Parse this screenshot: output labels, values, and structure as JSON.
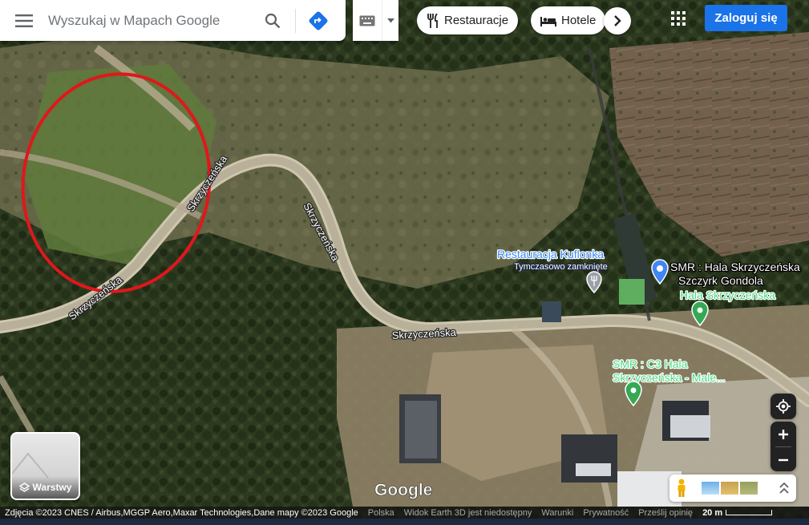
{
  "search": {
    "placeholder": "Wyszukaj w Mapach Google"
  },
  "chips": [
    {
      "label": "Restauracje",
      "icon": "fork-knife-icon"
    },
    {
      "label": "Hotele",
      "icon": "bed-icon"
    }
  ],
  "header": {
    "signin_label": "Zaloguj się"
  },
  "layers": {
    "label": "Warstwy"
  },
  "map": {
    "roads": [
      "Skrzyczeńska",
      "Skrzyczeńska",
      "Skrzyczeńska",
      "Skrzyczeńska"
    ],
    "places": {
      "restaurant_name": "Restauracja Kuflonka",
      "restaurant_status": "Tymczasowo zamknięte",
      "gondola_line1": "SMR : Hala Skrzyczeńska",
      "gondola_line2": "Szczyrk Gondola",
      "hala_name": "Hala Skrzyczeńska",
      "c3_line1": "SMR : C3 Hala",
      "c3_line2": "Skrzyczeńska - Male..."
    },
    "google_logo": "Google"
  },
  "footer": {
    "imagery": "Zdjęcia ©2023 CNES / Airbus,MGGP Aero,Maxar Technologies,Dane mapy ©2023 Google",
    "country": "Polska",
    "earth3d": "Widok Earth 3D jest niedostępny",
    "terms": "Warunki",
    "privacy": "Prywatność",
    "feedback": "Prześlij opinię",
    "scale": "20 m"
  },
  "colors": {
    "accent": "#1a73e8",
    "circle": "#e0171c",
    "restaurant_pin": "#9aa0a6",
    "green_pin": "#34a853",
    "blue_pin": "#4285f4"
  }
}
